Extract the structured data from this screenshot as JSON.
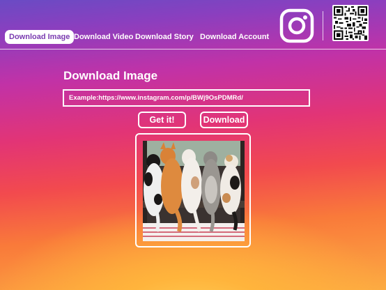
{
  "nav": {
    "items": [
      {
        "label": "Download Image",
        "active": true
      },
      {
        "label": "Download Video",
        "active": false
      },
      {
        "label": "Download Story",
        "active": false
      },
      {
        "label": "Download Account",
        "active": false
      }
    ]
  },
  "header_icons": {
    "brand_icon": "instagram-icon",
    "qr_icon": "qr-code-icon"
  },
  "main": {
    "title": "Download Image",
    "url_input": {
      "value": "",
      "placeholder": "Example:https://www.instagram.com/p/BWj9OsPDMRd/"
    },
    "get_button": "Get it!",
    "download_button": "Download",
    "preview_image": "five-cats-at-window-photo"
  },
  "colors": {
    "gradient_top": "#6a4bc4",
    "gradient_mid": "#e23476",
    "gradient_bottom": "#fcaa43",
    "active_tab_text": "#7a3bb0"
  }
}
